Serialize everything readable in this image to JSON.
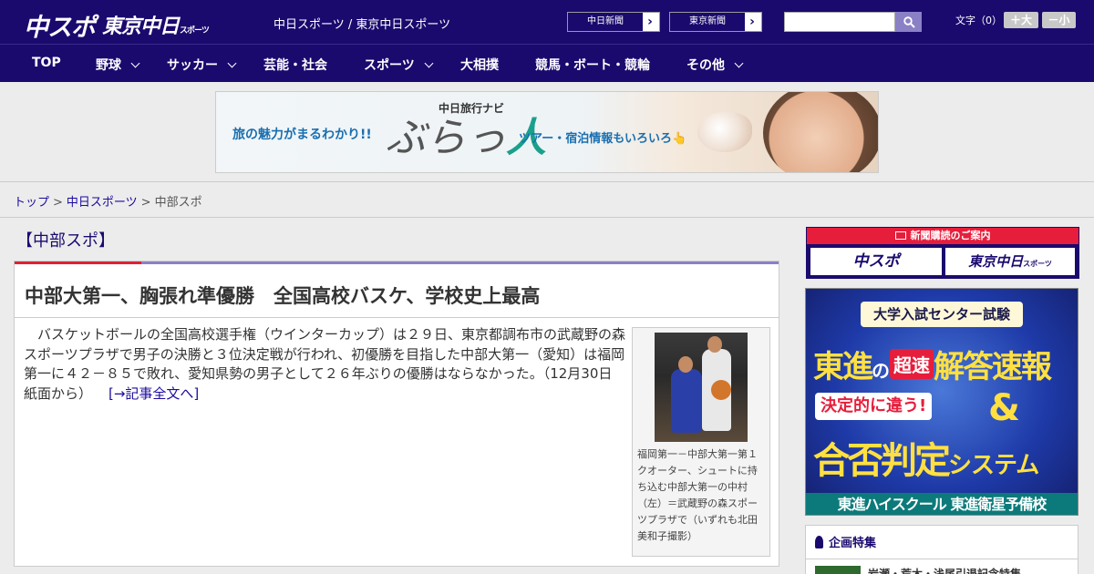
{
  "header": {
    "logo_chuspo": "中スポ",
    "logo_tokyo": "東京中日",
    "logo_tokyo_sub": "スポーツ",
    "site_title": "中日スポーツ / 東京中日スポーツ",
    "btn_chunichi": "中日新聞",
    "btn_tokyo": "東京新聞",
    "arrow": "›",
    "search_placeholder": "",
    "fontsize_label": "文字（0）",
    "fontsize_big": "＋大",
    "fontsize_small": "－小"
  },
  "nav": {
    "items": [
      {
        "label": "TOP",
        "has_menu": false
      },
      {
        "label": "野球",
        "has_menu": true
      },
      {
        "label": "サッカー",
        "has_menu": true
      },
      {
        "label": "芸能・社会",
        "has_menu": false
      },
      {
        "label": "スポーツ",
        "has_menu": true
      },
      {
        "label": "大相撲",
        "has_menu": false
      },
      {
        "label": "競馬・ボート・競輪",
        "has_menu": false
      },
      {
        "label": "その他",
        "has_menu": true
      }
    ]
  },
  "banner_ad": {
    "lead": "旅の魅力がまるわかり!!",
    "navi": "中日旅行ナビ",
    "logo": "ぶらっ",
    "logo_accent": "人",
    "tail": "ツアー・宿泊情報もいろいろ👆"
  },
  "breadcrumb": {
    "items": [
      "トップ",
      "中日スポーツ",
      "中部スポ"
    ],
    "sep": ">"
  },
  "main": {
    "section_title": "【中部スポ】",
    "headline": "中部大第一、胸張れ準優勝　全国高校バスケ、学校史上最高",
    "body": "バスケットボールの全国高校選手権（ウインターカップ）は２９日、東京都調布市の武蔵野の森スポーツプラザで男子の決勝と３位決定戦が行われ、初優勝を目指した中部大第一（愛知）は福岡第一に４２－８５で敗れ、愛知県勢の男子として２６年ぶりの優勝はならなかった。（12月30日 紙面から）",
    "read_more": "[→記事全文へ]",
    "photo_caption": "福岡第一－中部大第一第１クオーター、シュートに持ち込む中部大第一の中村（左）＝武蔵野の森スポーツプラザで（いずれも北田美和子撮影）"
  },
  "sidebar": {
    "subscribe_head": "新聞購読のご案内",
    "subscribe_chuspo": "中スポ",
    "subscribe_tokyo": "東京中日",
    "subscribe_tokyo_sub": "スポーツ",
    "ad": {
      "top": "大学入試センター試験",
      "line1_a": "東進",
      "line1_b": "の",
      "line1_red": "超速",
      "line1_c": "解答速報",
      "line2": "決定的に違う!",
      "amp": "&",
      "line3_a": "合否判定",
      "line3_b": "システム",
      "foot": "東進ハイスクール 東進衛星予備校"
    },
    "feature_title": "企画特集",
    "feature_item": "岩瀬・荒木・浅尾引退記念特集"
  },
  "colors": {
    "brand_navy": "#1a0a6e",
    "accent_red": "#e61e3c",
    "link_blue": "#1a0a9e",
    "search_btn": "#8a80c6"
  }
}
